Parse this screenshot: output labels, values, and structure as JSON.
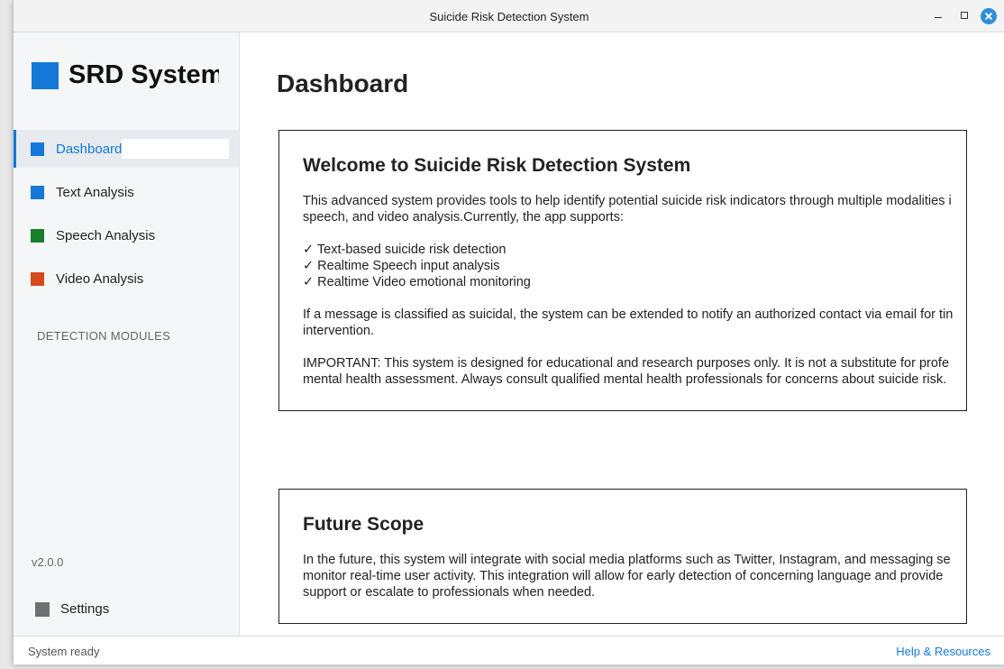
{
  "window": {
    "title": "Suicide Risk Detection System"
  },
  "sidebar": {
    "app_name": "SRD System",
    "nav": [
      {
        "label": "Dashboard",
        "color": "#1479d6",
        "active": true
      },
      {
        "label": "Text Analysis",
        "color": "#1479d6"
      },
      {
        "label": "Speech Analysis",
        "color": "#1a7f2a"
      },
      {
        "label": "Video Analysis",
        "color": "#d54a1a"
      }
    ],
    "section_label": "DETECTION MODULES",
    "version": "v2.0.0",
    "settings_label": "Settings"
  },
  "main": {
    "title": "Dashboard",
    "welcome": {
      "heading": "Welcome to Suicide Risk Detection System",
      "intro_line1": "This advanced system provides tools to help identify potential suicide risk indicators through multiple modalities i",
      "intro_line2": "speech, and video analysis.Currently, the app supports:",
      "features": [
        "✓ Text-based suicide risk detection",
        "✓ Realtime Speech input analysis",
        "✓ Realtime Video emotional monitoring"
      ],
      "alert_line1": "If a message is classified as suicidal, the system can be extended to notify an authorized contact via email for tin",
      "alert_line2": "intervention.",
      "important_line1": "IMPORTANT: This system is designed for educational and research purposes only. It is not a substitute for profe",
      "important_line2": "mental health assessment. Always consult qualified mental health professionals for concerns about suicide risk."
    },
    "future": {
      "heading": "Future Scope",
      "line1": "In the future, this system will integrate with social media platforms such as Twitter, Instagram, and messaging se",
      "line2": "monitor real-time user activity. This integration will allow for early detection of concerning language and provide",
      "line3": "support or escalate to professionals when needed."
    }
  },
  "statusbar": {
    "status": "System ready",
    "help_link": "Help & Resources"
  },
  "colors": {
    "accent": "#1479d6"
  }
}
